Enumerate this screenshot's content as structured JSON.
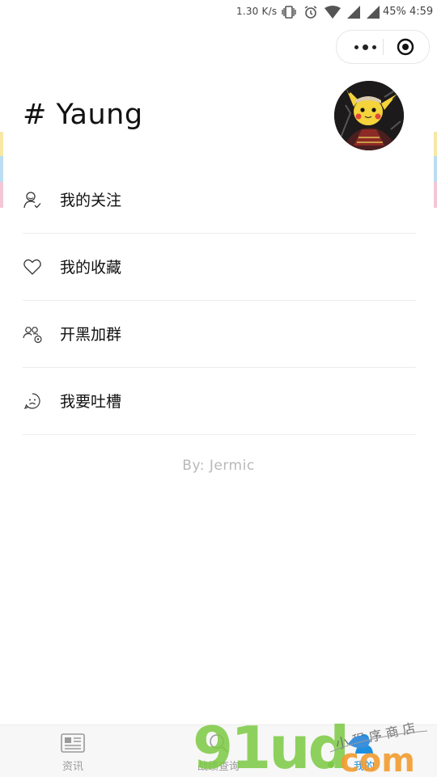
{
  "status_bar": {
    "network_speed": "1.30 K/s",
    "battery": "45%",
    "time": "4:59"
  },
  "header": {
    "title": "# Yaung"
  },
  "menu": [
    {
      "icon": "user-check-icon",
      "label": "我的关注"
    },
    {
      "icon": "heart-icon",
      "label": "我的收藏"
    },
    {
      "icon": "group-add-icon",
      "label": "开黑加群"
    },
    {
      "icon": "frown-face-icon",
      "label": "我要吐槽"
    }
  ],
  "footer": {
    "credit": "By: Jermic"
  },
  "tabbar": {
    "tabs": [
      {
        "icon": "news-icon",
        "label": "资讯"
      },
      {
        "icon": "search-icon",
        "label": "战绩查询"
      },
      {
        "icon": "profile-icon",
        "label": "我的"
      }
    ],
    "active_color": "#1f8fe0"
  },
  "watermark": {
    "logo": "91ud.com",
    "tagline": "小程序商店"
  }
}
